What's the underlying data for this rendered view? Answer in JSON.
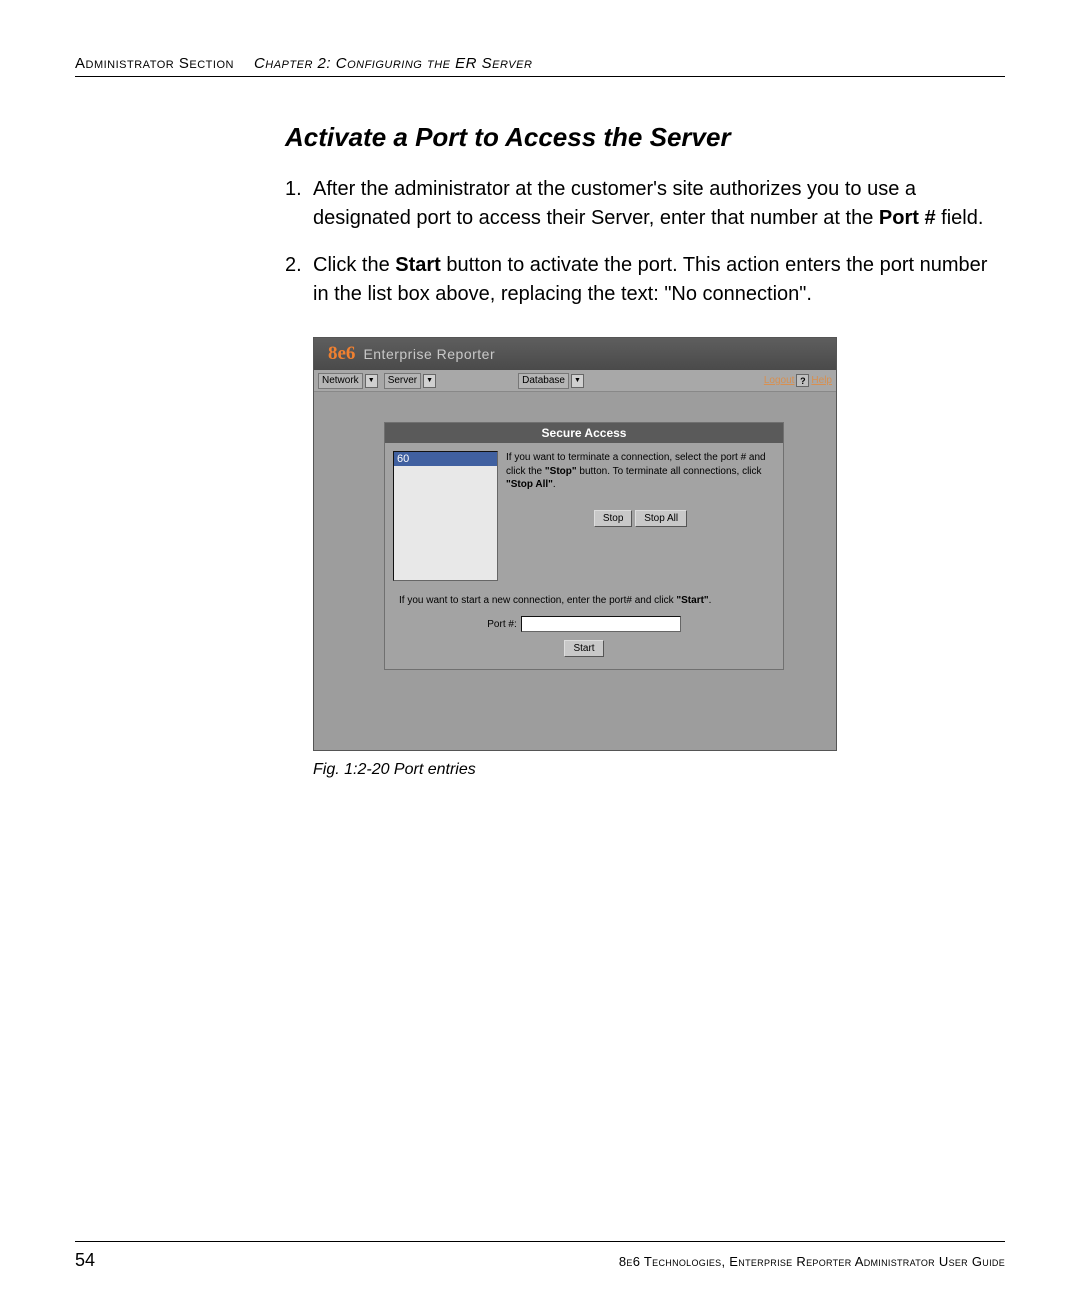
{
  "header": {
    "section": "Administrator Section",
    "chapter": "Chapter 2: Configuring the ER Server"
  },
  "heading": "Activate a Port to Access the Server",
  "steps": {
    "one_a": "After the administrator at the customer's site authorizes you to use a designated port to access their Server, enter that number at the ",
    "one_bold": "Port #",
    "one_b": " field.",
    "two_a": "Click the ",
    "two_bold": "Start",
    "two_b": " button to activate the port. This action enters the port number in the list box above, replacing the text: \"No connection\"."
  },
  "app": {
    "logo_main": "8e6",
    "logo_sub": "Enterprise Reporter",
    "menu": {
      "network": "Network",
      "server": "Server",
      "database": "Database",
      "logout": "Logout",
      "help": "Help",
      "help_icon": "?"
    },
    "panel": {
      "title": "Secure Access",
      "port_list_value": "60",
      "stop_instruction_a": "If you want to terminate a connection, select the port # and click the ",
      "stop_instruction_bold1": "\"Stop\"",
      "stop_instruction_b": " button. To terminate all connections, click ",
      "stop_instruction_bold2": "\"Stop All\"",
      "stop_instruction_c": ".",
      "stop_btn": "Stop",
      "stop_all_btn": "Stop All",
      "start_hint_a": "If you want to start a new connection, enter the port# and click ",
      "start_hint_bold": "\"Start\"",
      "start_hint_b": ".",
      "port_label": "Port #:",
      "start_btn": "Start"
    }
  },
  "figure_caption": "Fig. 1:2-20  Port entries",
  "footer": {
    "page_number": "54",
    "text": "8e6 Technologies, Enterprise Reporter Administrator User Guide"
  }
}
